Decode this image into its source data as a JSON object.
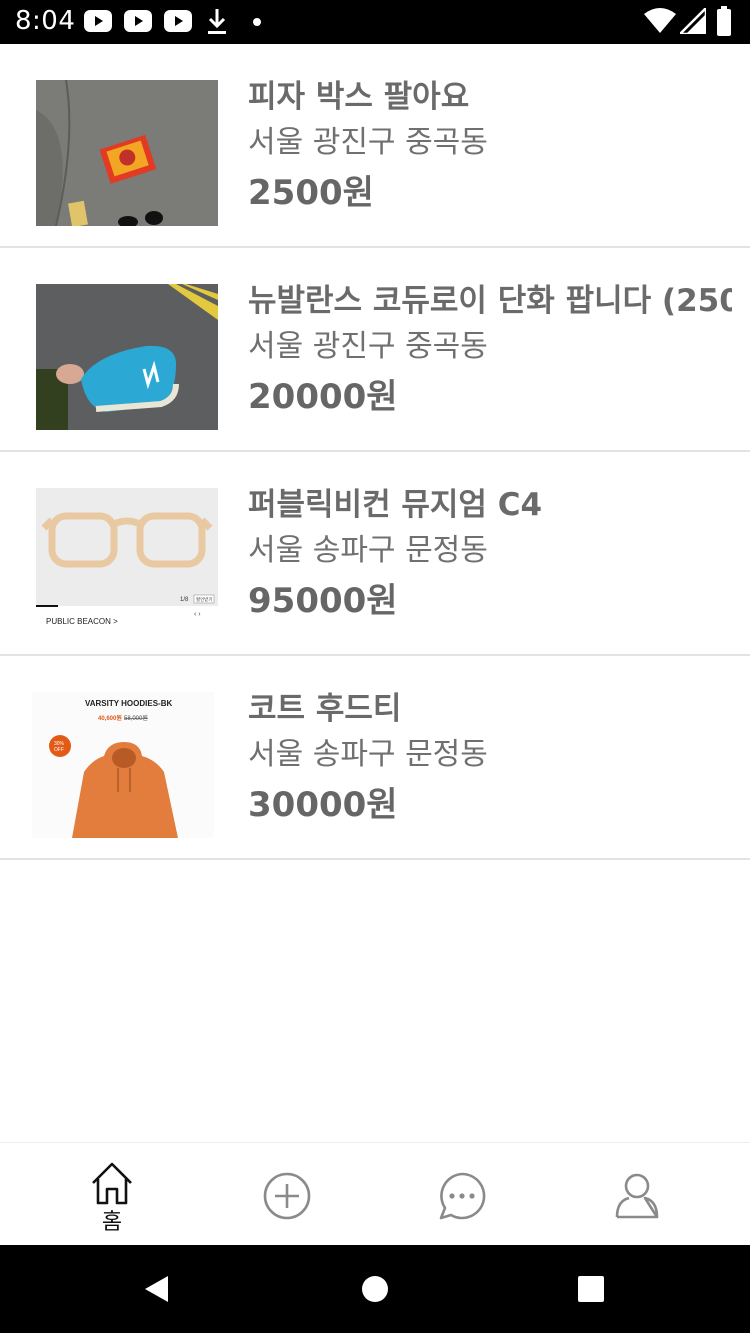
{
  "status_bar": {
    "time": "8:04",
    "left_icons": [
      "youtube-icon",
      "youtube-icon",
      "youtube-icon",
      "download-icon",
      "dot-icon"
    ],
    "right_icons": [
      "wifi-icon",
      "signal-icon",
      "battery-icon"
    ]
  },
  "items": [
    {
      "title": "피자 박스 팔아요",
      "location": "서울 광진구 중곡동",
      "price": "2500원"
    },
    {
      "title": "뉴발란스 코듀로이 단화 팝니다 (250",
      "location": "서울 광진구 중곡동",
      "price": "20000원"
    },
    {
      "title": "퍼블릭비컨 뮤지엄 C4",
      "location": "서울 송파구 문정동",
      "price": "95000원",
      "thumb_text": {
        "brand": "PUBLIC BEACON >",
        "counter": "1/8",
        "button": "할인받기"
      }
    },
    {
      "title": "코트 후드티",
      "location": "서울 송파구 문정동",
      "price": "30000원",
      "thumb_text": {
        "heading": "VARSITY HOODIES-BK",
        "sale": "40,600원",
        "orig": "58,000원",
        "badge_top": "30%",
        "badge_bottom": "OFF"
      }
    }
  ],
  "bottom_nav": {
    "home_label": "홈",
    "icons": [
      "home-icon",
      "add-circle-icon",
      "chat-icon",
      "profile-icon"
    ]
  },
  "android_nav": [
    "back-icon",
    "home-circle-icon",
    "recents-icon"
  ]
}
